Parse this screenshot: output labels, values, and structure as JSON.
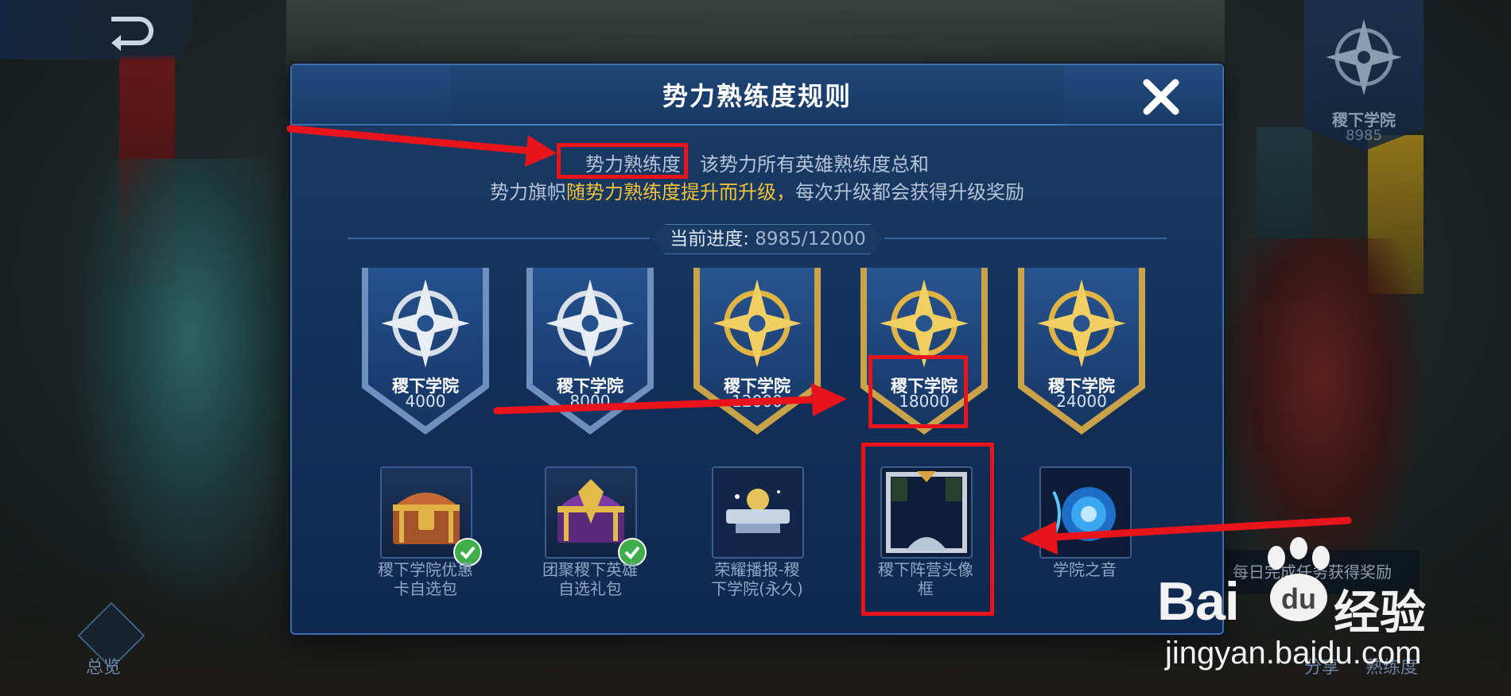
{
  "background": {
    "overview_label": "总览",
    "bottom_links": [
      "分享",
      "熟练度"
    ],
    "tip_text": "每日完成任务获得奖励",
    "faction_badge": {
      "name": "稷下学院",
      "value": "8985"
    }
  },
  "dialog": {
    "title": "势力熟练度规则",
    "close_icon": "close-icon",
    "rule_line1_term": "势力熟练度",
    "rule_line1_rest": "：该势力所有英雄熟练度总和",
    "rule_line2_prefix": "势力旗帜",
    "rule_line2_highlight": "随势力熟练度提升而升级，",
    "rule_line2_suffix": "每次升级都会获得升级奖励",
    "progress_label": "当前进度:",
    "progress_value": "8985/12000",
    "progress": {
      "current": 8985,
      "total": 12000
    },
    "tiers": [
      {
        "name": "稷下学院",
        "value": "4000",
        "style": "silver"
      },
      {
        "name": "稷下学院",
        "value": "8000",
        "style": "silver"
      },
      {
        "name": "稷下学院",
        "value": "12000",
        "style": "gold"
      },
      {
        "name": "稷下学院",
        "value": "18000",
        "style": "gold"
      },
      {
        "name": "稷下学院",
        "value": "24000",
        "style": "gold"
      }
    ],
    "rewards": [
      {
        "label_line1": "稷下学院优惠",
        "label_line2": "卡自选包",
        "claimed": true,
        "icon": "treasure-chest-icon"
      },
      {
        "label_line1": "团聚稷下英雄",
        "label_line2": "自选礼包",
        "claimed": true,
        "icon": "purple-chest-icon"
      },
      {
        "label_line1": "荣耀播报-稷",
        "label_line2": "下学院(永久)",
        "claimed": false,
        "icon": "broadcast-banner-icon"
      },
      {
        "label_line1": "稷下阵营头像",
        "label_line2": "框",
        "claimed": false,
        "icon": "avatar-frame-icon"
      },
      {
        "label_line1": "学院之音",
        "label_line2": "",
        "claimed": false,
        "icon": "sound-orb-icon"
      }
    ]
  },
  "watermark": {
    "brand": "Bai",
    "brand2": "经验",
    "url": "jingyan.baidu.com"
  },
  "colors": {
    "highlight": "#f2c23a",
    "annotation": "#e8141c",
    "dialog_bg": "#13305a"
  }
}
